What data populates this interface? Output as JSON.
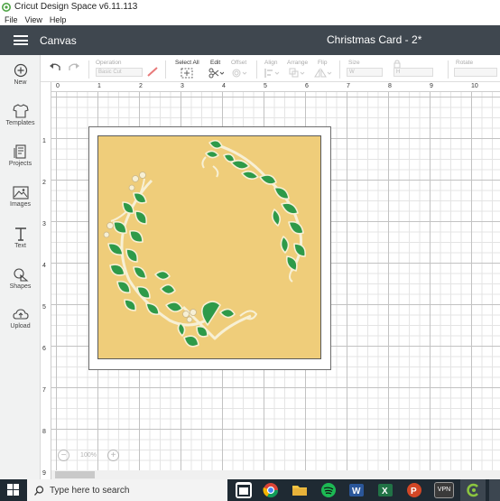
{
  "window": {
    "title": "Cricut Design Space  v6.11.113"
  },
  "menu": {
    "items": [
      "File",
      "View",
      "Help"
    ]
  },
  "header": {
    "section": "Canvas",
    "project_title": "Christmas Card - 2*"
  },
  "toolbar": {
    "operation_label": "Operation",
    "operation_value": "Basic Cut",
    "select_all_label": "Select All",
    "edit_label": "Edit",
    "offset_label": "Offset",
    "align_label": "Align",
    "arrange_label": "Arrange",
    "flip_label": "Flip",
    "size_label": "Size",
    "size_w": "W",
    "size_h": "H",
    "rotate_label": "Rotate"
  },
  "sidebar": {
    "items": [
      {
        "label": "New",
        "icon": "plus-circle-icon"
      },
      {
        "label": "Templates",
        "icon": "tshirt-icon"
      },
      {
        "label": "Projects",
        "icon": "projects-icon"
      },
      {
        "label": "Images",
        "icon": "image-icon"
      },
      {
        "label": "Text",
        "icon": "text-icon"
      },
      {
        "label": "Shapes",
        "icon": "shapes-icon"
      },
      {
        "label": "Upload",
        "icon": "upload-cloud-icon"
      }
    ]
  },
  "ruler": {
    "top": [
      "0",
      "1",
      "2",
      "3",
      "4",
      "5",
      "6",
      "7",
      "8",
      "9",
      "10"
    ],
    "left": [
      "1",
      "2",
      "3",
      "4",
      "5",
      "6",
      "7",
      "8",
      "9"
    ]
  },
  "zoom": {
    "value": "100%"
  },
  "taskbar": {
    "search_placeholder": "Type here to search",
    "vpn_label": "VPN"
  },
  "colors": {
    "header": "#3f474f",
    "card": "#efcd7a",
    "leaf": "#2e9a49",
    "vine": "#f7f0d5",
    "taskbar": "#1f2a33"
  }
}
